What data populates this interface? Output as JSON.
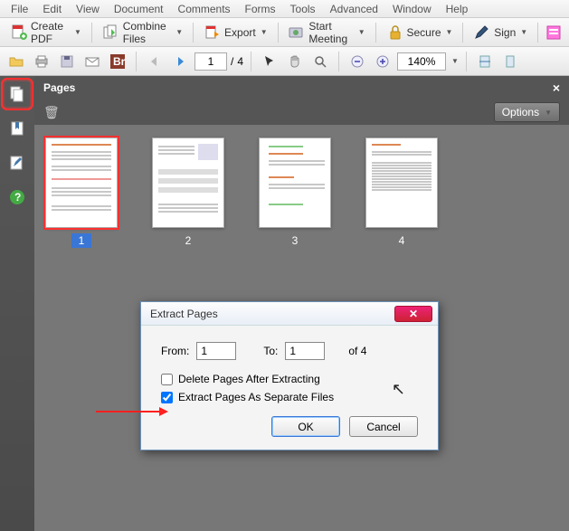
{
  "menu": {
    "items": [
      "File",
      "Edit",
      "View",
      "Document",
      "Comments",
      "Forms",
      "Tools",
      "Advanced",
      "Window",
      "Help"
    ]
  },
  "toolbar1": {
    "createPdf": "Create PDF",
    "combineFiles": "Combine Files",
    "export": "Export",
    "startMeeting": "Start Meeting",
    "secure": "Secure",
    "sign": "Sign"
  },
  "toolbar2": {
    "currentPage": "1",
    "pageSep": "/",
    "totalPages": "4",
    "zoom": "140%"
  },
  "panel": {
    "title": "Pages",
    "optionsLabel": "Options"
  },
  "thumbs": [
    {
      "label": "1",
      "selected": true
    },
    {
      "label": "2",
      "selected": false
    },
    {
      "label": "3",
      "selected": false
    },
    {
      "label": "4",
      "selected": false
    }
  ],
  "dialog": {
    "title": "Extract Pages",
    "fromLabel": "From:",
    "fromValue": "1",
    "toLabel": "To:",
    "toValue": "1",
    "ofLabel": "of 4",
    "deleteAfter": {
      "label": "Delete Pages After Extracting",
      "checked": false
    },
    "extractSeparate": {
      "label": "Extract Pages As Separate Files",
      "checked": true
    },
    "ok": "OK",
    "cancel": "Cancel"
  },
  "colors": {
    "highlight": "#ff3030",
    "selection": "#3a76d6"
  }
}
